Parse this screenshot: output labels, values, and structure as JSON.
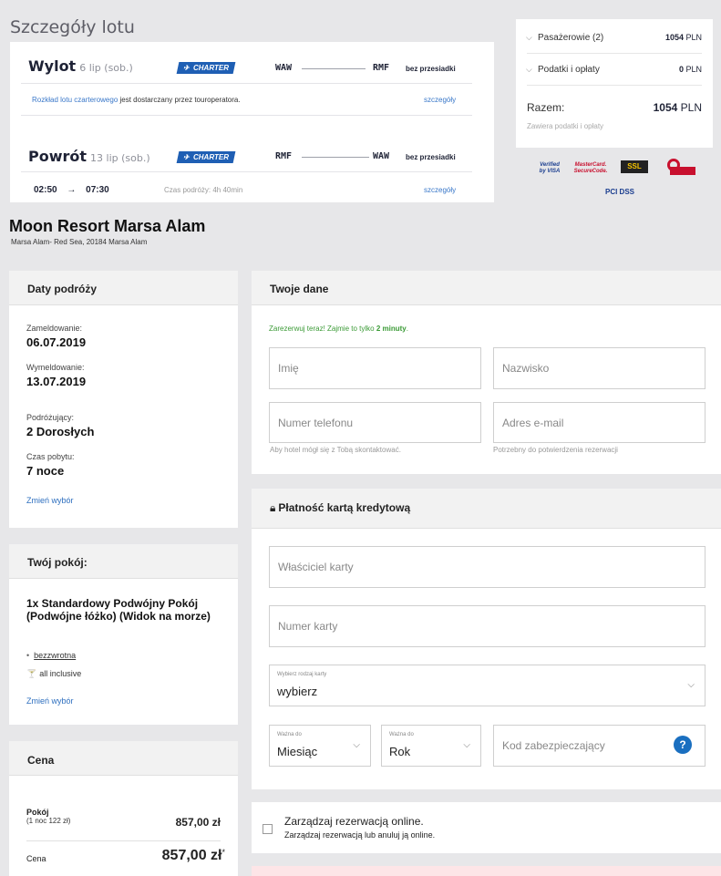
{
  "flight": {
    "section_title": "Szczegóły lotu",
    "outbound": {
      "label": "Wylot",
      "date": "6 lip (sob.)",
      "badge": "CHARTER",
      "from": "WAW",
      "to": "RMF",
      "stops": "bez przesiadki",
      "note_link": "Rozkład lotu czarterowego",
      "note_rest": " jest dostarczany przez touroperatora.",
      "details_link": "szczegóły"
    },
    "return": {
      "label": "Powrót",
      "date": "13 lip (sob.)",
      "badge": "CHARTER",
      "from": "RMF",
      "to": "WAW",
      "stops": "bez przesiadki",
      "dep_time": "02:50",
      "arrow": "→",
      "arr_time": "07:30",
      "duration": "Czas podróży: 4h 40min",
      "details_link": "szczegóły"
    }
  },
  "price_summary": {
    "passengers_label": "Pasażerowie (2)",
    "passengers_value": "1054",
    "fees_label": "Podatki i opłaty",
    "fees_value": "0",
    "currency": "PLN",
    "total_label": "Razem:",
    "total_value": "1054",
    "total_note": "Zawiera podatki i opłaty"
  },
  "trust_badges": {
    "visa": "Verified by VISA",
    "mastercard": "MasterCard. SecureCode.",
    "ssl": "SSL",
    "pci": "PCI DSS"
  },
  "hotel": {
    "name": "Moon Resort Marsa Alam",
    "address": "Marsa Alam- Red Sea, 20184 Marsa Alam"
  },
  "travel_dates": {
    "title": "Daty podróży",
    "checkin_label": "Zameldowanie:",
    "checkin_value": "06.07.2019",
    "checkout_label": "Wymeldowanie:",
    "checkout_value": "13.07.2019",
    "travelers_label": "Podróżujący:",
    "travelers_value": "2 Dorosłych",
    "stay_label": "Czas pobytu:",
    "stay_value": "7 noce",
    "change_link": "Zmień wybór"
  },
  "room": {
    "title": "Twój pokój:",
    "name": "1x Standardowy Podwójny Pokój (Podwójne łóżko) (Widok na morze)",
    "feature_refund": "bezzwrotna",
    "feature_board": "all inclusive",
    "change_link": "Zmień wybór"
  },
  "price": {
    "title": "Cena",
    "room_label": "Pokój",
    "room_sub": "(1 noc 122 zł)",
    "room_value": "857,00 zł",
    "total_label": "Cena",
    "total_value": "857,00 zł",
    "total_mark": "*"
  },
  "your_data": {
    "title": "Twoje dane",
    "promo_text": "Zarezerwuj teraz! Zajmie to tylko ",
    "promo_bold": "2 minuty",
    "promo_end": ".",
    "first_name_placeholder": "Imię",
    "last_name_placeholder": "Nazwisko",
    "phone_placeholder": "Numer telefonu",
    "email_placeholder": "Adres e-mail",
    "phone_hint": "Aby hotel mógł się z Tobą skontaktować.",
    "email_hint": "Potrzebny do potwierdzenia rezerwacji"
  },
  "payment": {
    "title": "Płatność kartą kredytową",
    "holder_placeholder": "Właściciel karty",
    "number_placeholder": "Numer karty",
    "card_type_label": "Wybierz rodzaj karty",
    "card_type_value": "wybierz",
    "month_label": "Ważna do",
    "month_value": "Miesiąc",
    "year_label": "Ważna do",
    "year_value": "Rok",
    "cvv_placeholder": "Kod zabezpieczający",
    "cvv_help": "?"
  },
  "manage": {
    "title": "Zarządzaj rezerwacją online.",
    "subtitle": "Zarządzaj rezerwacją lub anuluj ją online."
  },
  "colors": {
    "accent_blue": "#1f5fb4",
    "link_blue": "#2e6fbf",
    "promo_green": "#3a9a35",
    "help_blue": "#1a6fc0"
  }
}
